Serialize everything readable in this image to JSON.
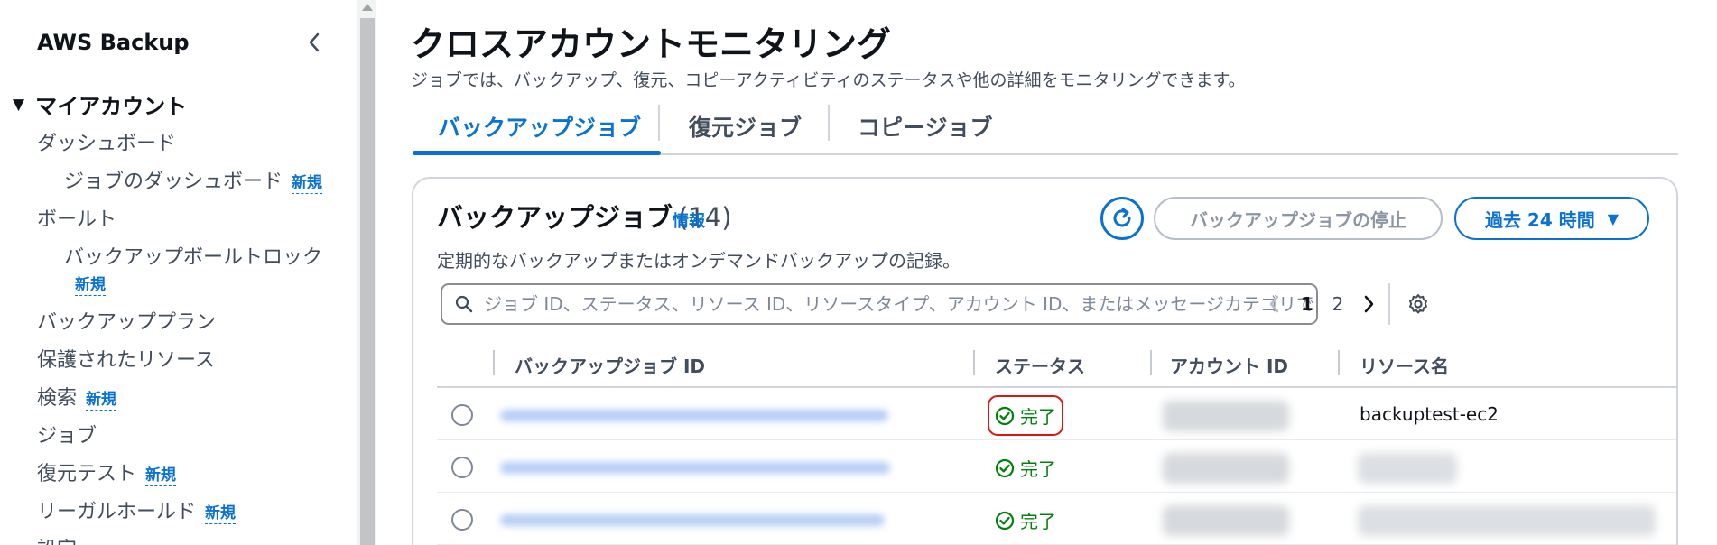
{
  "sidebar": {
    "title": "AWS Backup",
    "section": "マイアカウント",
    "new_badge": "新規",
    "items": [
      {
        "label": "ダッシュボード"
      },
      {
        "label": "ジョブのダッシュボード"
      },
      {
        "label": "ボールト"
      },
      {
        "label": "バックアップボールトロック"
      },
      {
        "label": "バックアッププラン"
      },
      {
        "label": "保護されたリソース"
      },
      {
        "label": "検索"
      },
      {
        "label": "ジョブ"
      },
      {
        "label": "復元テスト"
      },
      {
        "label": "リーガルホールド"
      },
      {
        "label": "設定"
      }
    ]
  },
  "main": {
    "title": "クロスアカウントモニタリング",
    "description": "ジョブでは、バックアップ、復元、コピーアクティビティのステータスや他の詳細をモニタリングできます。",
    "tabs": [
      {
        "label": "バックアップジョブ",
        "active": true
      },
      {
        "label": "復元ジョブ",
        "active": false
      },
      {
        "label": "コピージョブ",
        "active": false
      }
    ]
  },
  "card": {
    "title": "バックアップジョブ",
    "count": "(14)",
    "info": "情報",
    "description": "定期的なバックアップまたはオンデマンドバックアップの記録。",
    "stop_button": "バックアップジョブの停止",
    "range_button": "過去 24 時間",
    "search_placeholder": "ジョブ ID、ステータス、リソース ID、リソースタイプ、アカウント ID、またはメッセージカテゴリでフィルタリング",
    "pages": [
      "1",
      "2"
    ],
    "current_page": "1"
  },
  "table": {
    "headers": [
      "バックアップジョブ ID",
      "ステータス",
      "アカウント ID",
      "リソース名"
    ],
    "rows": [
      {
        "status": "完了",
        "resource_name": "backuptest-ec2"
      },
      {
        "status": "完了",
        "resource_name": ""
      },
      {
        "status": "完了",
        "resource_name": ""
      }
    ]
  },
  "colors": {
    "accent": "#0972d3",
    "success": "#037f0c",
    "highlight": "#d91515"
  }
}
